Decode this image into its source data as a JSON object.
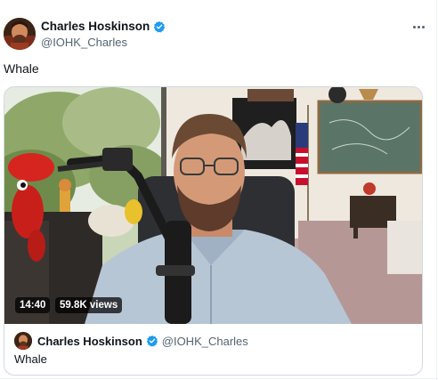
{
  "post": {
    "author_name": "Charles Hoskinson",
    "author_handle": "@IOHK_Charles",
    "text": "Whale"
  },
  "video": {
    "duration": "14:40",
    "views": "59.8K views"
  },
  "quoted_post": {
    "author_name": "Charles Hoskinson",
    "author_handle": "@IOHK_Charles",
    "text": "Whale"
  },
  "icons": {
    "verified": "verified-badge-icon",
    "more": "more-options-icon"
  },
  "colors": {
    "verified_blue": "#1d9bf0",
    "secondary_text": "#536471",
    "border": "#cfd9de"
  }
}
